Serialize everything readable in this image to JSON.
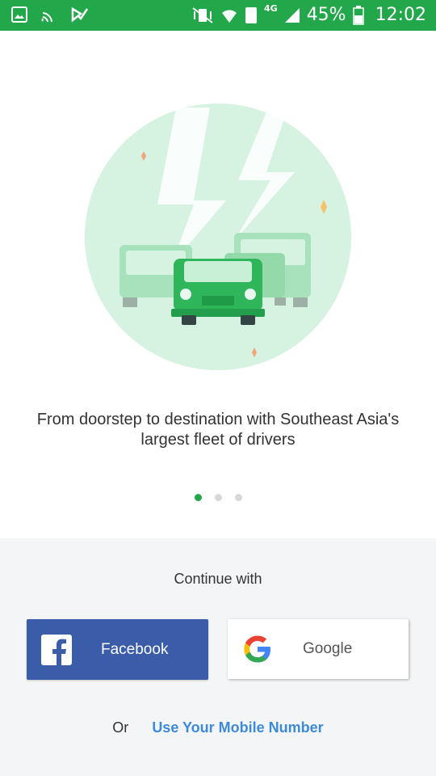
{
  "status_bar": {
    "battery_percent": "45%",
    "time": "12:02",
    "network": "4G",
    "sim_slot": "1",
    "icons": [
      "image-icon",
      "wifi-calling-icon",
      "check-icon",
      "mute-vibrate-icon",
      "wifi-icon",
      "sim-icon",
      "signal-icon",
      "battery-icon"
    ]
  },
  "onboarding": {
    "tagline": "From doorstep to destination with Southeast Asia's largest fleet of drivers",
    "page_count": 3,
    "active_page": 1
  },
  "login": {
    "continue_with": "Continue with",
    "facebook_label": "Facebook",
    "google_label": "Google",
    "or_text": "Or",
    "mobile_link": "Use Your Mobile Number"
  },
  "colors": {
    "brand_green": "#22a84a",
    "facebook_blue": "#3b5ca8",
    "link_blue": "#3c8ad8"
  }
}
